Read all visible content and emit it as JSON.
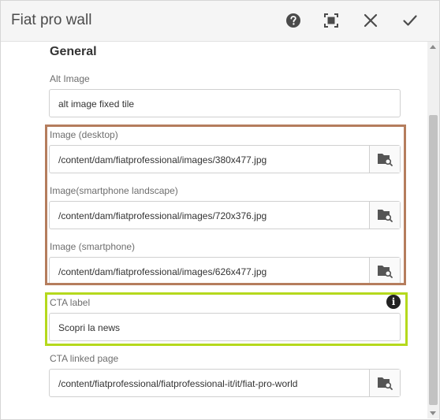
{
  "dialog": {
    "title": "Fiat pro wall",
    "actions": {
      "help_icon": "help-icon",
      "fullscreen_icon": "fullscreen-icon",
      "close_icon": "close-icon",
      "done_icon": "check-icon"
    }
  },
  "section": {
    "title": "General"
  },
  "fields": {
    "alt_image": {
      "label": "Alt Image",
      "value": "alt image fixed tile"
    },
    "image_desktop": {
      "label": "Image (desktop)",
      "value": "/content/dam/fiatprofessional/images/380x477.jpg"
    },
    "image_landscape": {
      "label": "Image(smartphone landscape)",
      "value": "/content/dam/fiatprofessional/images/720x376.jpg"
    },
    "image_smartphone": {
      "label": "Image (smartphone)",
      "value": "/content/dam/fiatprofessional/images/626x477.jpg"
    },
    "cta_label": {
      "label": "CTA label",
      "value": "Scopri la news"
    },
    "cta_link": {
      "label": "CTA linked page",
      "value": "/content/fiatprofessional/fiatprofessional-it/it/fiat-pro-world"
    }
  },
  "colors": {
    "highlight_brown": "#b57d5d",
    "highlight_green": "#b5d91d"
  }
}
